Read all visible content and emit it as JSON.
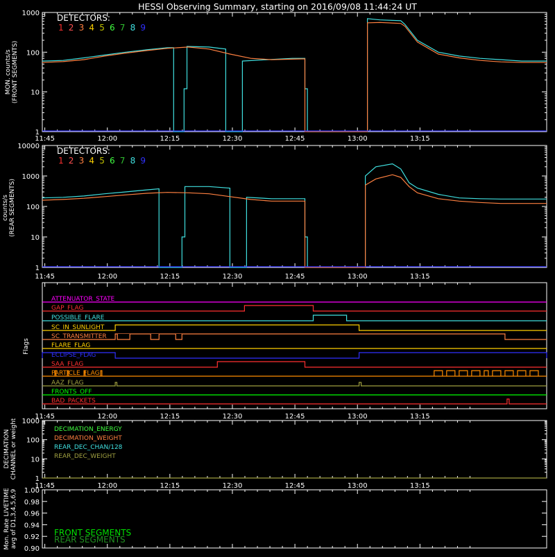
{
  "title": "HESSI Observing Summary, starting on 2016/09/08 11:44:24 UT",
  "time_ticks": [
    "11:45",
    "12:00",
    "12:15",
    "12:30",
    "12:45",
    "13:00",
    "13:15"
  ],
  "detector_legend": {
    "title": "DETECTORS:",
    "items": [
      {
        "label": "1",
        "color": "#ff3030"
      },
      {
        "label": "2",
        "color": "#ff5050"
      },
      {
        "label": "3",
        "color": "#ff8040"
      },
      {
        "label": "4",
        "color": "#ffd000"
      },
      {
        "label": "5",
        "color": "#c0c000"
      },
      {
        "label": "6",
        "color": "#40ff40"
      },
      {
        "label": "7",
        "color": "#30c030"
      },
      {
        "label": "8",
        "color": "#40e0e0"
      },
      {
        "label": "9",
        "color": "#3030ff"
      }
    ]
  },
  "flag_labels": {
    "ylabel": "Flags",
    "items": [
      {
        "label": "ATTENUATOR_STATE",
        "color": "#ff00ff"
      },
      {
        "label": "GAP_FLAG",
        "color": "#ff3030"
      },
      {
        "label": "POSSIBLE_FLARE",
        "color": "#40e0e0"
      },
      {
        "label": "SC_IN_SUNLIGHT",
        "color": "#ffd000"
      },
      {
        "label": "SC_TRANSMITTER",
        "color": "#ff8040"
      },
      {
        "label": "FLARE_FLAG",
        "color": "#ffd000"
      },
      {
        "label": "ECLIPSE_FLAG",
        "color": "#3030ff"
      },
      {
        "label": "SAA_FLAG",
        "color": "#ff3030"
      },
      {
        "label": "PARTICLE_FLAG",
        "color": "#ff8c00"
      },
      {
        "label": "AAZ_FLAG",
        "color": "#a0a040"
      },
      {
        "label": "FRONTS_OFF",
        "color": "#00ff00"
      },
      {
        "label": "BAD_PACKETS",
        "color": "#ff3030"
      }
    ]
  },
  "decimation_legend": [
    {
      "label": "DECIMATION_ENERGY",
      "color": "#40ff40"
    },
    {
      "label": "DECIMATION_WEIGHT",
      "color": "#ff8040"
    },
    {
      "label": "REAR_DEC_CHAN/128",
      "color": "#40e0e0"
    },
    {
      "label": "REAR_DEC_WEIGHT",
      "color": "#a0a040"
    }
  ],
  "livetime_legend": [
    {
      "label": "FRONT SEGMENTS",
      "color": "#00e000"
    },
    {
      "label": "REAR SEGMENTS",
      "color": "#209020"
    }
  ],
  "chart_data": [
    {
      "type": "line",
      "panel": "front",
      "ylabel": "MON. counts/s (FRONT SEGMENTS)",
      "yscale": "log",
      "ylim": [
        1,
        1000
      ],
      "yticks": [
        "1",
        "10",
        "100",
        "1000"
      ],
      "x_unit": "minutes since 11:44:24",
      "xlim": [
        0,
        101
      ],
      "series": [
        {
          "name": "8",
          "color": "#40e0e0",
          "points": [
            [
              0,
              60
            ],
            [
              5,
              62
            ],
            [
              10,
              72
            ],
            [
              15,
              85
            ],
            [
              20,
              100
            ],
            [
              25,
              115
            ],
            [
              30,
              130
            ],
            [
              31.5,
              130
            ],
            [
              31.5,
              1
            ],
            [
              34,
              1
            ],
            [
              34,
              12
            ],
            [
              34.7,
              12
            ],
            [
              34.7,
              140
            ],
            [
              40,
              135
            ],
            [
              44,
              120
            ],
            [
              44,
              1
            ],
            [
              48,
              1
            ],
            [
              48,
              60
            ],
            [
              60,
              70
            ],
            [
              63,
              70
            ],
            [
              63,
              12
            ],
            [
              63.6,
              12
            ],
            [
              63.6,
              1
            ],
            [
              78,
              1
            ],
            [
              78,
              700
            ],
            [
              81,
              650
            ],
            [
              86,
              620
            ],
            [
              87,
              500
            ],
            [
              90,
              200
            ],
            [
              95,
              100
            ],
            [
              100,
              80
            ],
            [
              105,
              70
            ],
            [
              110,
              65
            ],
            [
              115,
              60
            ],
            [
              121,
              60
            ]
          ]
        },
        {
          "name": "3",
          "color": "#ff8040",
          "points": [
            [
              0,
              55
            ],
            [
              5,
              58
            ],
            [
              10,
              65
            ],
            [
              15,
              80
            ],
            [
              20,
              95
            ],
            [
              25,
              110
            ],
            [
              30,
              125
            ],
            [
              35,
              135
            ],
            [
              40,
              120
            ],
            [
              45,
              90
            ],
            [
              50,
              70
            ],
            [
              55,
              65
            ],
            [
              63,
              68
            ],
            [
              63,
              1
            ],
            [
              78,
              1
            ],
            [
              78,
              550
            ],
            [
              81,
              560
            ],
            [
              86,
              530
            ],
            [
              87,
              450
            ],
            [
              90,
              180
            ],
            [
              95,
              90
            ],
            [
              100,
              72
            ],
            [
              105,
              62
            ],
            [
              110,
              57
            ],
            [
              115,
              55
            ],
            [
              121,
              55
            ]
          ]
        }
      ]
    },
    {
      "type": "line",
      "panel": "rear",
      "ylabel": "counts/s (REAR SEGMENTS)",
      "yscale": "log",
      "ylim": [
        1,
        10000
      ],
      "yticks": [
        "1",
        "10",
        "100",
        "1000",
        "10000"
      ],
      "x_unit": "minutes since 11:44:24",
      "xlim": [
        0,
        101
      ],
      "series": [
        {
          "name": "8",
          "color": "#40e0e0",
          "points": [
            [
              0,
              190
            ],
            [
              5,
              200
            ],
            [
              10,
              220
            ],
            [
              15,
              260
            ],
            [
              20,
              300
            ],
            [
              25,
              350
            ],
            [
              28,
              380
            ],
            [
              28,
              1
            ],
            [
              33.5,
              1
            ],
            [
              33.5,
              10
            ],
            [
              34.2,
              10
            ],
            [
              34.2,
              450
            ],
            [
              40,
              450
            ],
            [
              45,
              400
            ],
            [
              45,
              1
            ],
            [
              49,
              1
            ],
            [
              49,
              200
            ],
            [
              55,
              180
            ],
            [
              63,
              180
            ],
            [
              63,
              10
            ],
            [
              63.6,
              10
            ],
            [
              63.6,
              1
            ],
            [
              77.5,
              1
            ],
            [
              77.5,
              1000
            ],
            [
              80,
              2000
            ],
            [
              84,
              2500
            ],
            [
              86,
              1700
            ],
            [
              88,
              600
            ],
            [
              90,
              400
            ],
            [
              95,
              250
            ],
            [
              100,
              190
            ],
            [
              105,
              180
            ],
            [
              110,
              175
            ],
            [
              115,
              175
            ],
            [
              121,
              175
            ]
          ]
        },
        {
          "name": "3",
          "color": "#ff8040",
          "points": [
            [
              0,
              160
            ],
            [
              5,
              170
            ],
            [
              10,
              185
            ],
            [
              15,
              210
            ],
            [
              20,
              240
            ],
            [
              25,
              270
            ],
            [
              30,
              290
            ],
            [
              35,
              280
            ],
            [
              40,
              260
            ],
            [
              45,
              210
            ],
            [
              50,
              170
            ],
            [
              55,
              150
            ],
            [
              63,
              150
            ],
            [
              63,
              1
            ],
            [
              77.5,
              1
            ],
            [
              77.5,
              500
            ],
            [
              80,
              800
            ],
            [
              84,
              1100
            ],
            [
              86,
              900
            ],
            [
              88,
              450
            ],
            [
              90,
              280
            ],
            [
              95,
              180
            ],
            [
              100,
              150
            ],
            [
              105,
              135
            ],
            [
              110,
              125
            ],
            [
              115,
              125
            ],
            [
              121,
              125
            ]
          ]
        }
      ]
    },
    {
      "type": "line",
      "panel": "decimation",
      "ylabel": "DECIMATION CHANNEL or weight",
      "yscale": "log",
      "ylim": [
        1,
        1000
      ],
      "yticks": [
        "1",
        "10",
        "100",
        "1000"
      ],
      "x_unit": "minutes since 11:44:24",
      "xlim": [
        0,
        101
      ],
      "series": [
        {
          "name": "REAR_DEC_WEIGHT",
          "color": "#a0a040",
          "points": [
            [
              0,
              1
            ],
            [
              121,
              1
            ]
          ]
        }
      ]
    },
    {
      "type": "line",
      "panel": "livetime",
      "ylabel": "Mon. Rate LIVETIME avg of D1,3,4,5,6,9",
      "yscale": "linear",
      "ylim": [
        0.9,
        1.0
      ],
      "yticks": [
        "0.90",
        "0.92",
        "0.94",
        "0.96",
        "0.98",
        "1.00"
      ],
      "x_unit": "minutes since 11:44:24",
      "xlim": [
        0,
        101
      ],
      "series": []
    }
  ]
}
